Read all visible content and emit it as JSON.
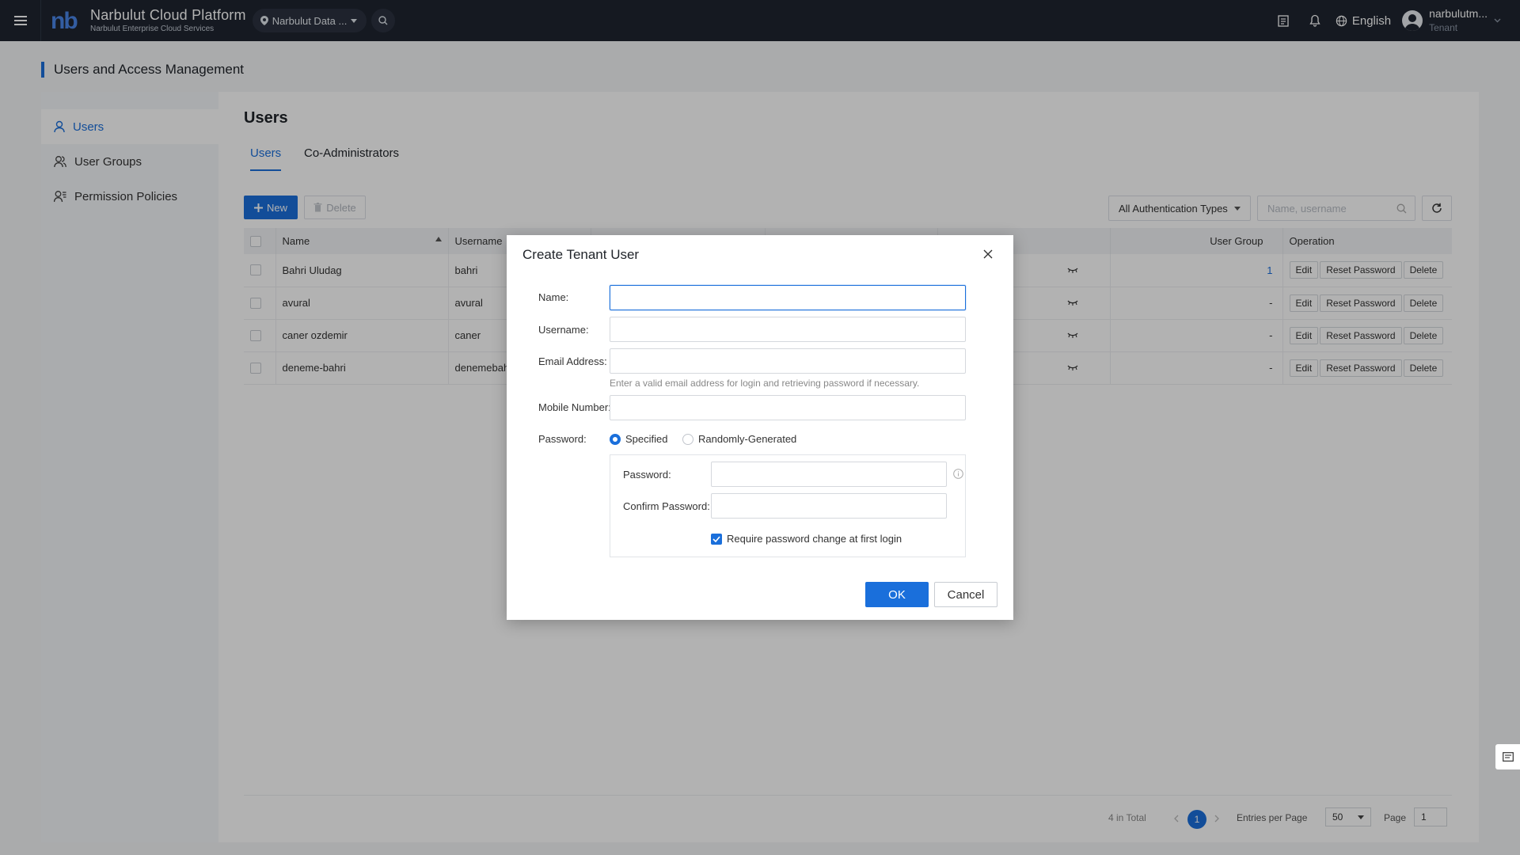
{
  "header": {
    "logo_text": "nb",
    "brand_title": "Narbulut Cloud Platform",
    "brand_subtitle": "Narbulut Enterprise Cloud Services",
    "region": "Narbulut Data ...",
    "language": "English",
    "user_name": "narbulutm...",
    "user_role": "Tenant"
  },
  "page": {
    "title": "Users and Access Management"
  },
  "sidebar": {
    "items": [
      {
        "label": "Users",
        "icon": "user-icon",
        "active": true
      },
      {
        "label": "User Groups",
        "icon": "user-group-icon",
        "active": false
      },
      {
        "label": "Permission Policies",
        "icon": "permission-icon",
        "active": false
      }
    ]
  },
  "main": {
    "title": "Users",
    "tabs": [
      {
        "label": "Users",
        "active": true
      },
      {
        "label": "Co-Administrators",
        "active": false
      }
    ],
    "toolbar": {
      "new_label": "New",
      "delete_label": "Delete",
      "auth_filter": "All Authentication Types",
      "search_placeholder": "Name, username"
    },
    "table": {
      "columns": [
        "Name",
        "Username",
        "User Group",
        "Operation"
      ],
      "rows": [
        {
          "name": "Bahri Uludag",
          "username": "bahri",
          "user_group": "1"
        },
        {
          "name": "avural",
          "username": "avural",
          "user_group": "-"
        },
        {
          "name": "caner ozdemir",
          "username": "caner",
          "user_group": "-"
        },
        {
          "name": "deneme-bahri",
          "username": "denemebahı",
          "user_group": "-"
        }
      ],
      "actions": [
        "Edit",
        "Reset Password",
        "Delete"
      ]
    },
    "pagination": {
      "total": "4 in Total",
      "current_page": "1",
      "entries_label": "Entries per Page",
      "entries_value": "50",
      "page_label": "Page",
      "page_value": "1"
    }
  },
  "dialog": {
    "title": "Create Tenant User",
    "name_label": "Name:",
    "username_label": "Username:",
    "email_label": "Email Address:",
    "email_hint": "Enter a valid email address for login and retrieving password if necessary.",
    "mobile_label": "Mobile Number:",
    "password_label": "Password:",
    "password_options": [
      "Specified",
      "Randomly-Generated"
    ],
    "pw_field_label": "Password:",
    "confirm_label": "Confirm Password:",
    "require_change": "Require password change at first login",
    "ok": "OK",
    "cancel": "Cancel"
  },
  "colors": {
    "accent": "#1a6fdb",
    "topbar": "#1f2530"
  }
}
